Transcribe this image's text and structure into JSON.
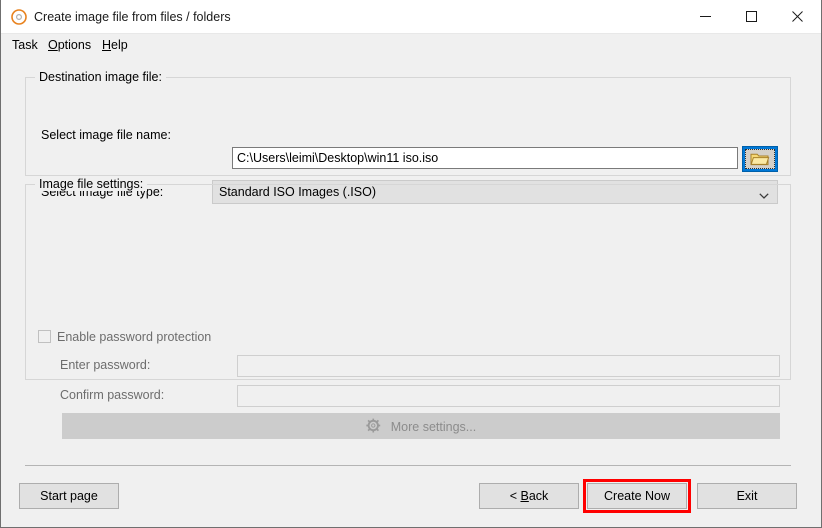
{
  "window": {
    "title": "Create image file from files / folders",
    "icon": "disc-icon",
    "accent_blue": "#0078d7",
    "highlight_red": "#ff0000",
    "background": "#f0f0f0",
    "controls": {
      "minimize": "minimize-icon",
      "maximize": "maximize-icon",
      "close": "close-icon"
    }
  },
  "menubar": {
    "items": [
      {
        "label": "Task",
        "mnemonic": ""
      },
      {
        "label": "Options",
        "mnemonic": "O"
      },
      {
        "label": "Help",
        "mnemonic": "H"
      }
    ],
    "task_label": "Task",
    "options_pre": "",
    "options_mnemonic": "O",
    "options_post": "ptions",
    "help_mnemonic": "H",
    "help_post": "elp"
  },
  "destination_group": {
    "legend": "Destination image file:",
    "file_name_label": "Select image file name:",
    "file_name_value": "C:\\Users\\leimi\\Desktop\\win11 iso.iso",
    "file_name_placeholder": "",
    "browse_button": "folder-open-icon",
    "file_type_label": "Select image file type:",
    "file_type_selected": "Standard ISO Images (.ISO)",
    "file_type_options": [
      "Standard ISO Images (.ISO)"
    ]
  },
  "settings_group": {
    "legend": "Image file settings:",
    "enable_password_label": "Enable password protection",
    "enable_password_checked": false,
    "enable_password_enabled": false,
    "enter_password_label": "Enter password:",
    "enter_password_value": "",
    "confirm_password_label": "Confirm password:",
    "confirm_password_value": "",
    "more_settings_label": "More settings...",
    "more_settings_icon": "gear-icon",
    "more_settings_enabled": false
  },
  "footer": {
    "start_page_label": "Start page",
    "back_label_pre": "< ",
    "back_mnemonic": "B",
    "back_label_post": "ack",
    "back_label": "< Back",
    "create_now_label": "Create Now",
    "exit_label": "Exit",
    "highlighted_button": "Create Now"
  }
}
